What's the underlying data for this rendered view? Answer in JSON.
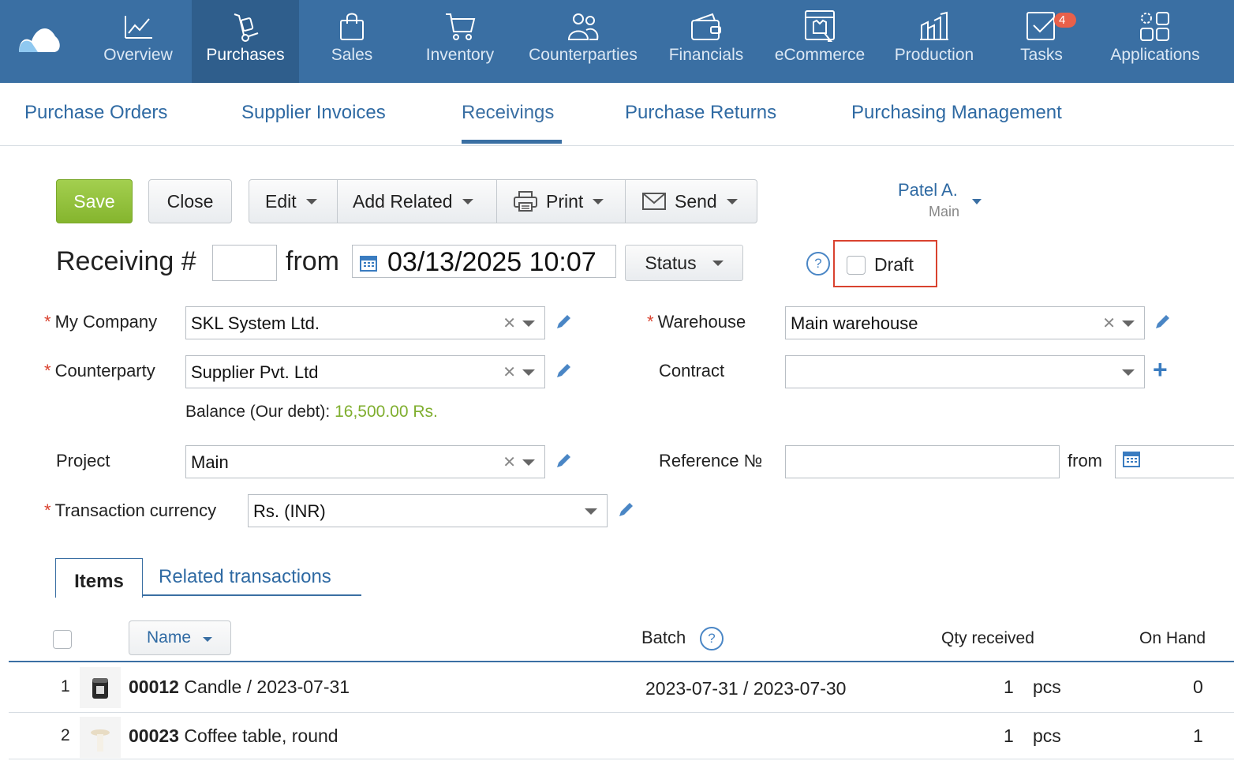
{
  "nav": {
    "items": [
      {
        "label": "Overview",
        "icon": "chart-line-icon"
      },
      {
        "label": "Purchases",
        "icon": "hand-truck-icon",
        "active": true
      },
      {
        "label": "Sales",
        "icon": "shopping-bag-icon"
      },
      {
        "label": "Inventory",
        "icon": "cart-icon"
      },
      {
        "label": "Counterparties",
        "icon": "people-icon"
      },
      {
        "label": "Financials",
        "icon": "wallet-icon"
      },
      {
        "label": "eCommerce",
        "icon": "store-icon"
      },
      {
        "label": "Production",
        "icon": "factory-icon"
      },
      {
        "label": "Tasks",
        "icon": "task-check-icon",
        "badge": "4"
      },
      {
        "label": "Applications",
        "icon": "apps-grid-icon"
      }
    ]
  },
  "subtabs": [
    "Purchase Orders",
    "Supplier Invoices",
    "Receivings",
    "Purchase Returns",
    "Purchasing Management"
  ],
  "toolbar": {
    "save": "Save",
    "close": "Close",
    "edit": "Edit",
    "add_related": "Add Related",
    "print": "Print",
    "send": "Send"
  },
  "user": {
    "name": "Patel A.",
    "sub": "Main"
  },
  "header": {
    "title": "Receiving #",
    "number": "",
    "from": "from",
    "date": "03/13/2025 10:07",
    "status": "Status",
    "help": "?",
    "draft": "Draft"
  },
  "form": {
    "my_company": {
      "label": "My Company",
      "value": "SKL System Ltd."
    },
    "counterparty": {
      "label": "Counterparty",
      "value": "Supplier Pvt. Ltd"
    },
    "balance_label": "Balance (Our debt):",
    "balance_value": "16,500.00 Rs.",
    "project": {
      "label": "Project",
      "value": "Main"
    },
    "currency": {
      "label": "Transaction currency",
      "value": "Rs. (INR)"
    },
    "warehouse": {
      "label": "Warehouse",
      "value": "Main warehouse"
    },
    "contract": {
      "label": "Contract",
      "value": ""
    },
    "reference": {
      "label": "Reference №",
      "value": "",
      "from": "from"
    },
    "required_mark": "*",
    "plus": "+"
  },
  "item_tabs": {
    "items": "Items",
    "related": "Related transactions"
  },
  "table": {
    "headers": {
      "name": "Name",
      "batch": "Batch",
      "qty": "Qty received",
      "onhand": "On Hand"
    },
    "rows": [
      {
        "n": "1",
        "code": "00012",
        "name": " Candle / 2023-07-31",
        "batch": "2023-07-31 / 2023-07-30",
        "qty": "1",
        "unit": "pcs",
        "onhand": "0"
      },
      {
        "n": "2",
        "code": "00023",
        "name": " Coffee table, round",
        "batch": "",
        "qty": "1",
        "unit": "pcs",
        "onhand": "1"
      }
    ]
  },
  "colors": {
    "nav_bg": "#3a6fa3",
    "save_green": "#8dbf35",
    "draft_highlight": "#d9422f",
    "balance_green": "#7fae2e"
  }
}
